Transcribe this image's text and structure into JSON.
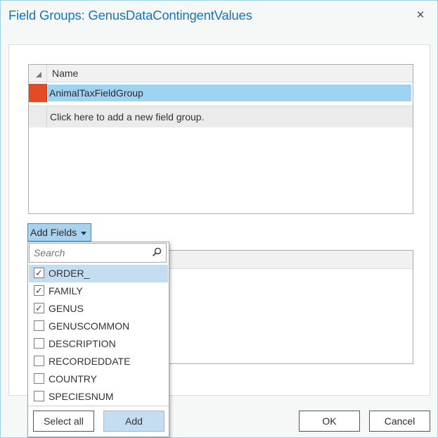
{
  "window": {
    "title": "Field Groups: GenusDataContingentValues",
    "close_label": "✕"
  },
  "field_groups_grid": {
    "column_header": "Name",
    "rows": [
      {
        "name": "AnimalTaxFieldGroup",
        "selected": true
      }
    ],
    "new_row_prompt": "Click here to add a new field group."
  },
  "add_fields": {
    "label": "Add Fields",
    "search_placeholder": "Search",
    "fields": [
      {
        "label": "ORDER_",
        "checked": true,
        "highlighted": true
      },
      {
        "label": "FAMILY",
        "checked": true,
        "highlighted": false
      },
      {
        "label": "GENUS",
        "checked": true,
        "highlighted": false
      },
      {
        "label": "GENUSCOMMON",
        "checked": false,
        "highlighted": false
      },
      {
        "label": "DESCRIPTION",
        "checked": false,
        "highlighted": false
      },
      {
        "label": "RECORDEDDATE",
        "checked": false,
        "highlighted": false
      },
      {
        "label": "COUNTRY",
        "checked": false,
        "highlighted": false
      },
      {
        "label": "SPECIESNUM",
        "checked": false,
        "highlighted": false
      }
    ],
    "select_all_label": "Select all",
    "add_label": "Add"
  },
  "footer": {
    "ok_label": "OK",
    "cancel_label": "Cancel"
  },
  "colors": {
    "title": "#1a73b8",
    "row_indicator": "#e44a24",
    "row_selected": "#9ed3f1",
    "highlight": "#c4ddf0"
  }
}
